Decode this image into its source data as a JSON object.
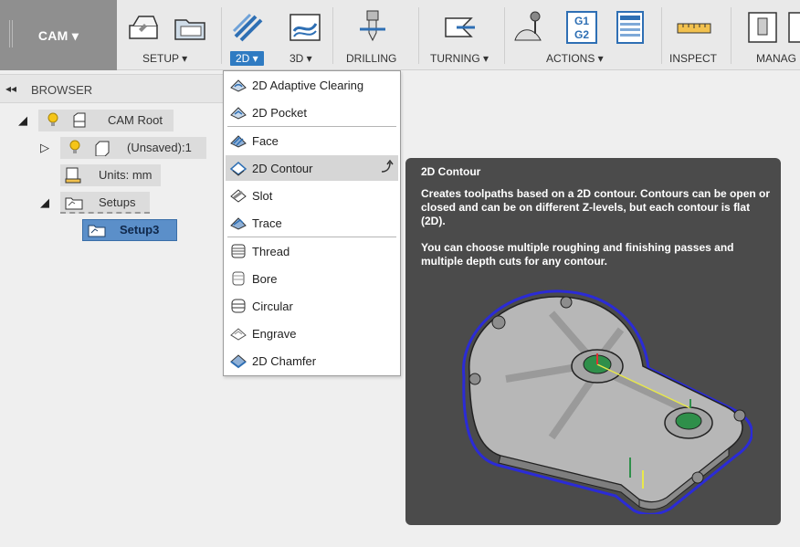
{
  "toolbar": {
    "workspace_label": "CAM ▾",
    "groups": {
      "setup": "SETUP ▾",
      "two_d": "2D ▾",
      "three_d": "3D ▾",
      "drilling": "DRILLING",
      "turning": "TURNING ▾",
      "actions": "ACTIONS ▾",
      "inspect": "INSPECT",
      "manage": "MANAG"
    },
    "g_code_icon": {
      "line1": "G1",
      "line2": "G2"
    }
  },
  "browser": {
    "title": "BROWSER",
    "collapse_glyph": "◂◂",
    "items": [
      {
        "label": "CAM Root"
      },
      {
        "label": "(Unsaved):1"
      },
      {
        "label": "Units: mm"
      },
      {
        "label": "Setups"
      },
      {
        "label": "Setup3"
      }
    ]
  },
  "dropdown": {
    "items": [
      {
        "label": "2D Adaptive Clearing"
      },
      {
        "label": "2D Pocket"
      },
      {
        "label": "Face"
      },
      {
        "label": "2D Contour"
      },
      {
        "label": "Slot"
      },
      {
        "label": "Trace"
      },
      {
        "label": "Thread"
      },
      {
        "label": "Bore"
      },
      {
        "label": "Circular"
      },
      {
        "label": "Engrave"
      },
      {
        "label": "2D Chamfer"
      }
    ],
    "active_item": "2D Contour"
  },
  "tooltip": {
    "title": "2D Contour",
    "description_1": "Creates toolpaths based on a 2D contour. Contours can be open or closed and can be on different Z-levels, but each contour is flat (2D).",
    "description_2": "You can choose multiple roughing and finishing passes and multiple depth cuts for any contour."
  },
  "colors": {
    "accent": "#2f7bc2",
    "tooltip_bg": "#4b4b4b",
    "selected_setup": "#5b8fc9",
    "toolpath": "#2b2bd6"
  }
}
